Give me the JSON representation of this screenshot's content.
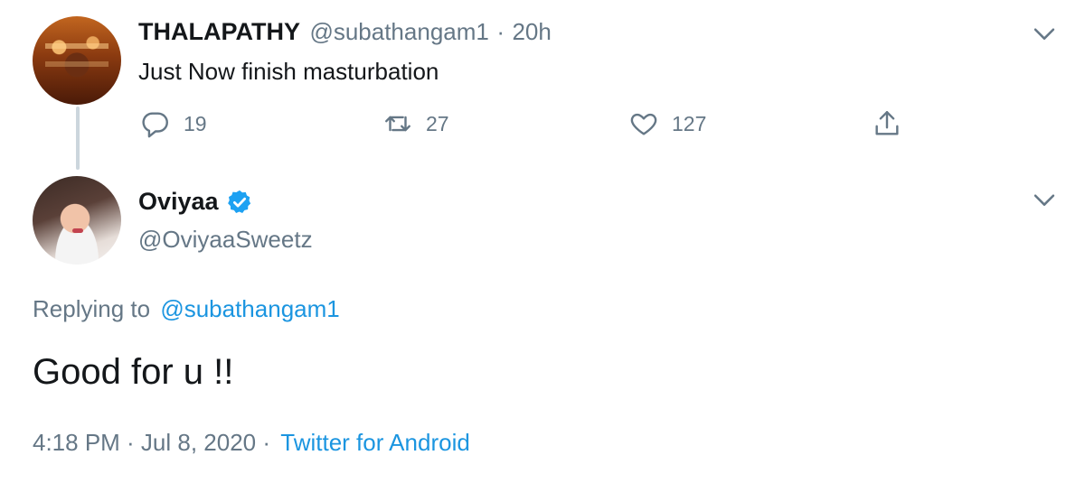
{
  "parent_tweet": {
    "name": "THALAPATHY",
    "handle": "@subathangam1",
    "separator": "·",
    "time": "20h",
    "text": "Just Now finish masturbation",
    "actions": {
      "replies": "19",
      "retweets": "27",
      "likes": "127"
    },
    "icons": [
      "reply-icon",
      "retweet-icon",
      "like-icon",
      "share-icon",
      "chevron-down-icon"
    ]
  },
  "main_tweet": {
    "name": "Oviyaa",
    "handle": "@OviyaaSweetz",
    "replying_prefix": "Replying to",
    "replying_to": "@subathangam1",
    "text": "Good for u !!",
    "timestamp": "4:18 PM · Jul 8, 2020 ·",
    "source": "Twitter for Android",
    "icons": [
      "verified-badge-icon",
      "chevron-down-icon"
    ]
  },
  "colors": {
    "link": "#1b95e0",
    "muted": "#657786",
    "text": "#14171a",
    "verified": "#1da1f2"
  }
}
